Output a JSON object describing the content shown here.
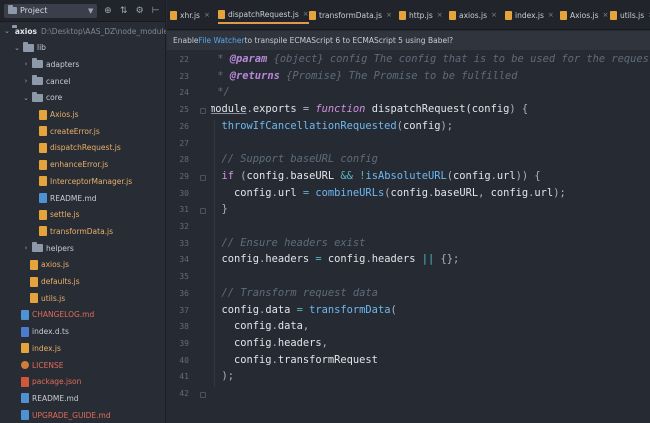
{
  "project": {
    "selector_label": "Project",
    "tree": [
      {
        "depth": 0,
        "type": "root",
        "name": "axios",
        "path": "D:\\Desktop\\AAS_DZ\\node_module"
      },
      {
        "depth": 1,
        "type": "folder",
        "open": true,
        "name": "lib"
      },
      {
        "depth": 2,
        "type": "folder",
        "open": false,
        "name": "adapters"
      },
      {
        "depth": 2,
        "type": "folder",
        "open": false,
        "name": "cancel"
      },
      {
        "depth": 2,
        "type": "folder",
        "open": true,
        "name": "core"
      },
      {
        "depth": 3,
        "type": "js",
        "name": "Axios.js"
      },
      {
        "depth": 3,
        "type": "js",
        "name": "createError.js"
      },
      {
        "depth": 3,
        "type": "js",
        "name": "dispatchRequest.js"
      },
      {
        "depth": 3,
        "type": "js",
        "name": "enhanceError.js"
      },
      {
        "depth": 3,
        "type": "js",
        "name": "InterceptorManager.js"
      },
      {
        "depth": 3,
        "type": "md",
        "name": "README.md"
      },
      {
        "depth": 3,
        "type": "js",
        "name": "settle.js"
      },
      {
        "depth": 3,
        "type": "js",
        "name": "transformData.js"
      },
      {
        "depth": 2,
        "type": "folder",
        "open": false,
        "name": "helpers"
      },
      {
        "depth": 2,
        "type": "js",
        "name": "axios.js"
      },
      {
        "depth": 2,
        "type": "js",
        "name": "defaults.js"
      },
      {
        "depth": 2,
        "type": "js",
        "name": "utils.js"
      },
      {
        "depth": 1,
        "type": "md-red",
        "name": "CHANGELOG.md"
      },
      {
        "depth": 1,
        "type": "ts",
        "name": "index.d.ts"
      },
      {
        "depth": 1,
        "type": "js",
        "name": "index.js"
      },
      {
        "depth": 1,
        "type": "license",
        "name": "LICENSE"
      },
      {
        "depth": 1,
        "type": "json",
        "name": "package.json"
      },
      {
        "depth": 1,
        "type": "md",
        "name": "README.md"
      },
      {
        "depth": 1,
        "type": "md-red",
        "name": "UPGRADE_GUIDE.md"
      }
    ]
  },
  "tabs": [
    {
      "label": "xhr.js",
      "active": false
    },
    {
      "label": "dispatchRequest.js",
      "active": true
    },
    {
      "label": "transformData.js",
      "active": false
    },
    {
      "label": "http.js",
      "active": false
    },
    {
      "label": "axios.js",
      "active": false
    },
    {
      "label": "index.js",
      "active": false
    },
    {
      "label": "Axios.js",
      "active": false
    },
    {
      "label": "utils.js",
      "active": false
    }
  ],
  "notice": {
    "prefix": "Enable ",
    "link": "File Watcher",
    "suffix": " to transpile ECMAScript 6 to ECMAScript 5 using Babel?"
  },
  "editor": {
    "line_numbers": [
      "22",
      "23",
      "24",
      "25",
      "26",
      "27",
      "28",
      "29",
      "30",
      "31",
      "32",
      "33",
      "34",
      "35",
      "36",
      "37",
      "38",
      "39",
      "40",
      "41",
      "42"
    ],
    "lines": [
      [
        {
          "c": "c-doc",
          "t": " * "
        },
        {
          "c": "c-tag",
          "t": "@param"
        },
        {
          "c": "c-doc",
          "t": " {object} config The config that is to be used for the request"
        }
      ],
      [
        {
          "c": "c-doc",
          "t": " * "
        },
        {
          "c": "c-tag",
          "t": "@returns"
        },
        {
          "c": "c-doc",
          "t": " {Promise} The Promise to be fulfilled"
        }
      ],
      [
        {
          "c": "c-doc",
          "t": " */"
        }
      ],
      [
        {
          "c": "c-mod",
          "t": "module"
        },
        {
          "c": "c-pun",
          "t": "."
        },
        {
          "c": "c-var",
          "t": "exports"
        },
        {
          "c": "c-pun",
          "t": " = "
        },
        {
          "c": "c-kwi",
          "t": "function"
        },
        {
          "c": "c-var",
          "t": " dispatchRequest("
        },
        {
          "c": "c-var",
          "t": "config"
        },
        {
          "c": "c-pun",
          "t": ") {"
        }
      ],
      [
        {
          "c": "c-fn",
          "t": "  throwIfCancellationRequested"
        },
        {
          "c": "c-pun",
          "t": "("
        },
        {
          "c": "c-var",
          "t": "config"
        },
        {
          "c": "c-pun",
          "t": ");"
        }
      ],
      [],
      [
        {
          "c": "c-cmt",
          "t": "  // Support baseURL config"
        }
      ],
      [
        {
          "c": "c-kw",
          "t": "  if"
        },
        {
          "c": "c-pun",
          "t": " ("
        },
        {
          "c": "c-var",
          "t": "config"
        },
        {
          "c": "c-pun",
          "t": "."
        },
        {
          "c": "c-prop",
          "t": "baseURL"
        },
        {
          "c": "c-op",
          "t": " && "
        },
        {
          "c": "c-op",
          "t": "!"
        },
        {
          "c": "c-fn",
          "t": "isAbsoluteURL"
        },
        {
          "c": "c-pun",
          "t": "("
        },
        {
          "c": "c-var",
          "t": "config"
        },
        {
          "c": "c-pun",
          "t": "."
        },
        {
          "c": "c-prop",
          "t": "url"
        },
        {
          "c": "c-pun",
          "t": ")) {"
        }
      ],
      [
        {
          "c": "c-var",
          "t": "    config"
        },
        {
          "c": "c-pun",
          "t": "."
        },
        {
          "c": "c-prop",
          "t": "url"
        },
        {
          "c": "c-op",
          "t": " = "
        },
        {
          "c": "c-fn",
          "t": "combineURLs"
        },
        {
          "c": "c-pun",
          "t": "("
        },
        {
          "c": "c-var",
          "t": "config"
        },
        {
          "c": "c-pun",
          "t": "."
        },
        {
          "c": "c-prop",
          "t": "baseURL"
        },
        {
          "c": "c-pun",
          "t": ", "
        },
        {
          "c": "c-var",
          "t": "config"
        },
        {
          "c": "c-pun",
          "t": "."
        },
        {
          "c": "c-prop",
          "t": "url"
        },
        {
          "c": "c-pun",
          "t": ");"
        }
      ],
      [
        {
          "c": "c-pun",
          "t": "  }"
        }
      ],
      [],
      [
        {
          "c": "c-cmt",
          "t": "  // Ensure headers exist"
        }
      ],
      [
        {
          "c": "c-var",
          "t": "  config"
        },
        {
          "c": "c-pun",
          "t": "."
        },
        {
          "c": "c-prop",
          "t": "headers"
        },
        {
          "c": "c-op",
          "t": " = "
        },
        {
          "c": "c-var",
          "t": "config"
        },
        {
          "c": "c-pun",
          "t": "."
        },
        {
          "c": "c-prop",
          "t": "headers"
        },
        {
          "c": "c-op",
          "t": " || "
        },
        {
          "c": "c-pun",
          "t": "{};"
        }
      ],
      [],
      [
        {
          "c": "c-cmt",
          "t": "  // Transform request data"
        }
      ],
      [
        {
          "c": "c-var",
          "t": "  config"
        },
        {
          "c": "c-pun",
          "t": "."
        },
        {
          "c": "c-prop",
          "t": "data"
        },
        {
          "c": "c-op",
          "t": " = "
        },
        {
          "c": "c-fn",
          "t": "transformData"
        },
        {
          "c": "c-pun",
          "t": "("
        }
      ],
      [
        {
          "c": "c-var",
          "t": "    config"
        },
        {
          "c": "c-pun",
          "t": "."
        },
        {
          "c": "c-prop",
          "t": "data"
        },
        {
          "c": "c-pun",
          "t": ","
        }
      ],
      [
        {
          "c": "c-var",
          "t": "    config"
        },
        {
          "c": "c-pun",
          "t": "."
        },
        {
          "c": "c-prop",
          "t": "headers"
        },
        {
          "c": "c-pun",
          "t": ","
        }
      ],
      [
        {
          "c": "c-var",
          "t": "    config"
        },
        {
          "c": "c-pun",
          "t": "."
        },
        {
          "c": "c-prop",
          "t": "transformRequest"
        }
      ],
      [
        {
          "c": "c-pun",
          "t": "  );"
        }
      ],
      []
    ]
  }
}
